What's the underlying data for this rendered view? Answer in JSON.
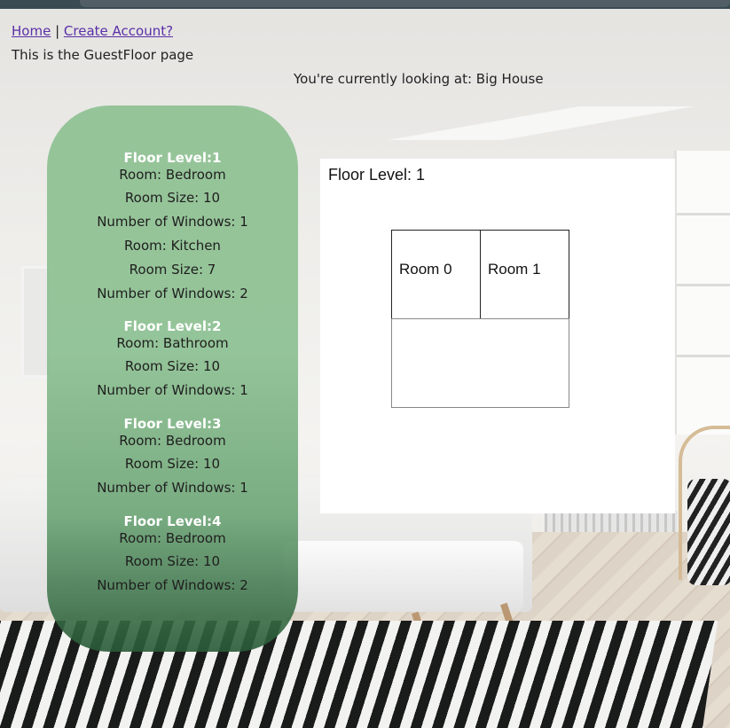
{
  "nav": {
    "home_label": "Home",
    "separator": "|",
    "create_account_label": "Create Account?"
  },
  "page_message": "This is the GuestFloor page",
  "current_house": "You're currently looking at: Big House",
  "floors": [
    {
      "title": "Floor Level:1",
      "rooms": [
        {
          "room": "Room: Bedroom",
          "size": "Room Size: 10",
          "windows": "Number of Windows: 1"
        },
        {
          "room": "Room: Kitchen",
          "size": "Room Size: 7",
          "windows": "Number of Windows: 2"
        }
      ]
    },
    {
      "title": "Floor Level:2",
      "rooms": [
        {
          "room": "Room: Bathroom",
          "size": "Room Size: 10",
          "windows": "Number of Windows: 1"
        }
      ]
    },
    {
      "title": "Floor Level:3",
      "rooms": [
        {
          "room": "Room: Bedroom",
          "size": "Room Size: 10",
          "windows": "Number of Windows: 1"
        }
      ]
    },
    {
      "title": "Floor Level:4",
      "rooms": [
        {
          "room": "Room: Bedroom",
          "size": "Room Size: 10",
          "windows": "Number of Windows: 2"
        }
      ]
    }
  ],
  "floor_plan": {
    "title": "Floor Level: 1",
    "rooms": [
      "Room 0",
      "Room 1"
    ]
  },
  "colors": {
    "panel_green": "#88be8c",
    "link_purple": "#5b2fa8",
    "floor_title_white": "#ffffff"
  }
}
